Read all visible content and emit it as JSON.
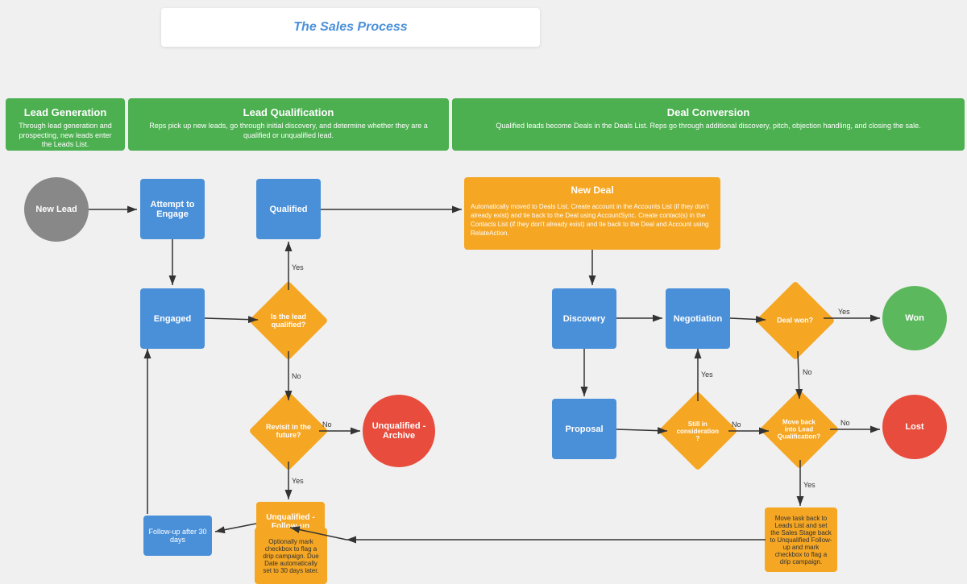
{
  "title": "The Sales Process",
  "sections": [
    {
      "id": "lead-gen",
      "label": "Lead Generation",
      "description": "Through lead generation and prospecting, new leads enter the Leads List."
    },
    {
      "id": "lead-qual",
      "label": "Lead Qualification",
      "description": "Reps pick up new leads, go through initial discovery, and determine whether they are a qualified or unqualified lead."
    },
    {
      "id": "deal-conv",
      "label": "Deal Conversion",
      "description": "Qualified leads become Deals in the Deals List. Reps go through additional discovery, pitch, objection handling, and closing the sale."
    }
  ],
  "nodes": {
    "new_lead": "New Lead",
    "attempt_to_engage": "Attempt to\nEngage",
    "engaged": "Engaged",
    "is_lead_qualified": "Is the lead\nqualified?",
    "qualified": "Qualified",
    "revisit_future": "Revisit in the\nfuture?",
    "unqualified_archive": "Unqualified -\nArchive",
    "unqualified_followup": "Unqualified -\nFollow-up",
    "followup_note": "Follow-up after 30 days",
    "unqualified_followup_desc": "Optionally mark checkbox to flag a drip campaign. Due Date automatically set to 30 days later.",
    "new_deal": "New Deal",
    "new_deal_desc": "Automatically moved to Deals List. Create account in the Accounts List (if they don't already exist) and tie back to the Deal using AccountSync. Create contact(s) in the Contacts List (if they don't already exist) and tie back to the Deal and Account using RelateAction.",
    "discovery": "Discovery",
    "proposal": "Proposal",
    "negotiation": "Negotiation",
    "still_in_consideration": "Still in\nconsideration\n?",
    "move_back_lead_qual": "Move back\ninto Lead\nQualification?",
    "won": "Won",
    "lost": "Lost",
    "deal_won": "Deal won?",
    "move_back_note": "Move task back to Leads List and set the Sales Stage back to Unqualified Follow-up and mark checkbox to flag a drip campaign."
  },
  "labels": {
    "yes": "Yes",
    "no": "No"
  }
}
